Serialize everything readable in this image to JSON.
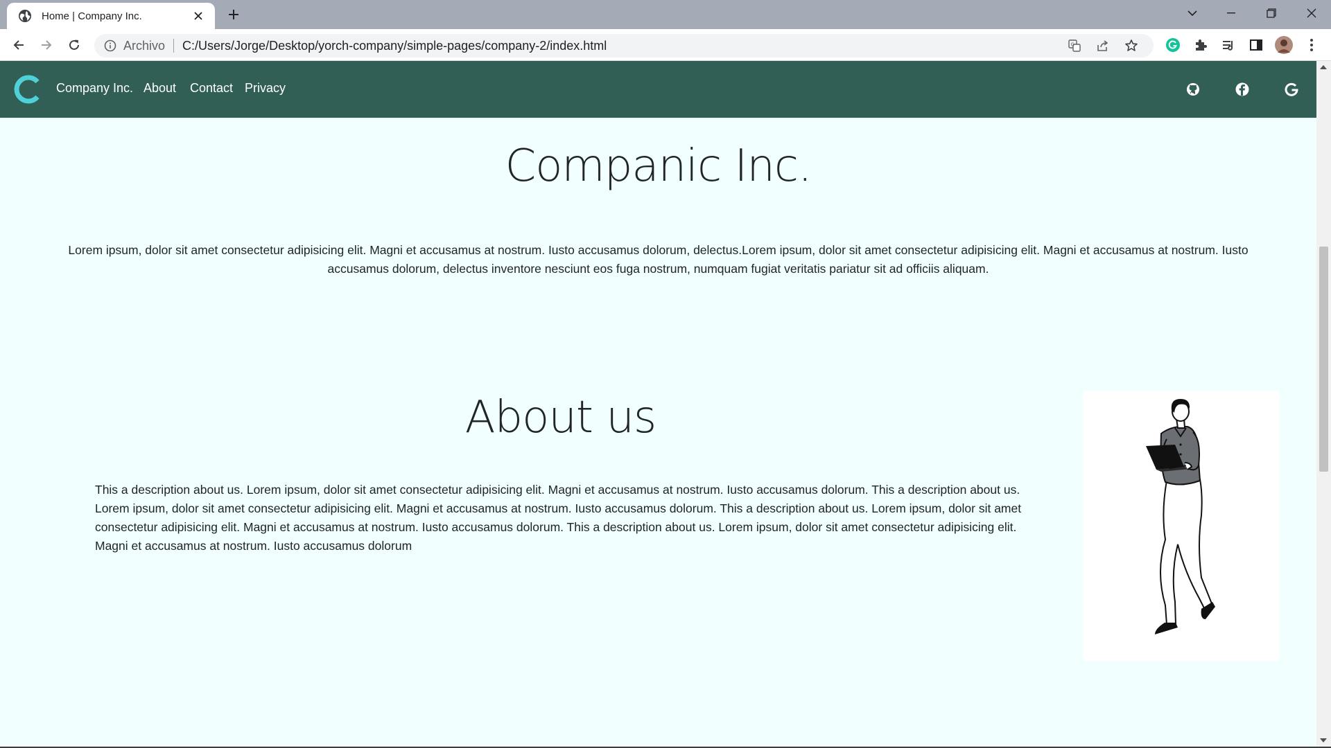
{
  "browser": {
    "tab_title": "Home | Company Inc.",
    "scheme_label": "Archivo",
    "url": "C:/Users/Jorge/Desktop/yorch-company/simple-pages/company-2/index.html",
    "colors": {
      "tabstrip": "#a5abb6",
      "toolbar": "#ffffff",
      "omnibox": "#f1f3f4",
      "grammarly": "#15c39a"
    }
  },
  "navbar": {
    "brand": "Company Inc.",
    "links": [
      "About",
      "Contact",
      "Privacy"
    ],
    "social_icons": [
      "github-icon",
      "facebook-icon",
      "google-icon"
    ],
    "colors": {
      "background": "#315f55",
      "logo": "#4fd1d9",
      "text": "#ffffff"
    }
  },
  "hero": {
    "title": "Companic Inc.",
    "text": "Lorem ipsum, dolor sit amet consectetur adipisicing elit. Magni et accusamus at nostrum. Iusto accusamus dolorum, delectus.Lorem ipsum, dolor sit amet consectetur adipisicing elit. Magni et accusamus at nostrum. Iusto accusamus dolorum, delectus inventore nesciunt eos fuga nostrum, numquam fugiat veritatis pariatur sit ad officiis aliquam."
  },
  "about": {
    "title": "About us",
    "text": "This a description about us. Lorem ipsum, dolor sit amet consectetur adipisicing elit. Magni et accusamus at nostrum. Iusto accusamus dolorum. This a description about us. Lorem ipsum, dolor sit amet consectetur adipisicing elit. Magni et accusamus at nostrum. Iusto accusamus dolorum. This a description about us. Lorem ipsum, dolor sit amet consectetur adipisicing elit. Magni et accusamus at nostrum. Iusto accusamus dolorum. This a description about us. Lorem ipsum, dolor sit amet consectetur adipisicing elit. Magni et accusamus at nostrum. Iusto accusamus dolorum",
    "image": "man-with-laptop-illustration"
  },
  "page": {
    "background": "#f1fffe"
  }
}
